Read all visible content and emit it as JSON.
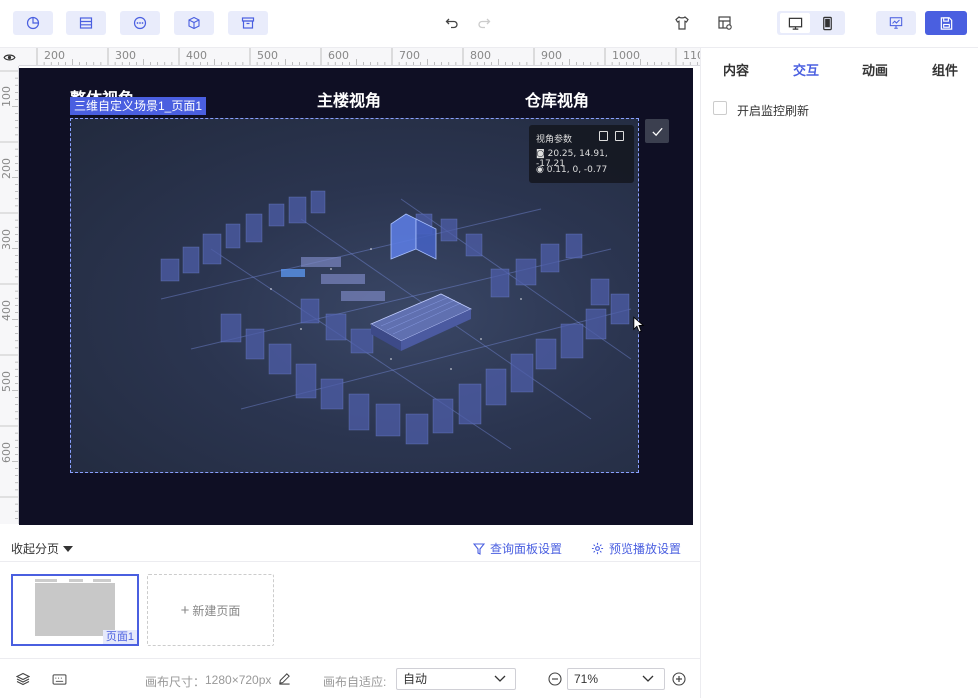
{
  "toolbar": {
    "left_icons": [
      "chart-icon",
      "table-icon",
      "more-circle-icon",
      "cube-icon",
      "archive-icon"
    ],
    "undo_icon": "undo-icon",
    "redo_icon": "redo-icon",
    "right_icons": [
      "shirt-icon",
      "layout-settings-icon",
      "desktop-icon",
      "mobile-icon",
      "preview-icon",
      "save-icon"
    ],
    "accent": "#4a5fe0"
  },
  "rulers": {
    "top_ticks": [
      "200",
      "300",
      "400",
      "500",
      "600",
      "700",
      "800",
      "900",
      "1000",
      "110"
    ],
    "left_ticks": [
      "100",
      "200",
      "300",
      "400",
      "500",
      "600"
    ]
  },
  "canvas": {
    "titles": [
      "整体视角",
      "主楼视角",
      "仓库视角"
    ],
    "scene_tag": "三维自定义场景1_页面1",
    "camera": {
      "title": "视角参数",
      "position": "20.25, 14.91, -17.21",
      "rotation": "0.11, 0, -0.77"
    },
    "background": "#0f0f24"
  },
  "pages": {
    "collapse_label": "收起分页",
    "query_label": "查询面板设置",
    "preview_label": "预览播放设置",
    "page_name": "页面1",
    "new_page_label": "新建页面"
  },
  "status": {
    "size_label": "画布尺寸：",
    "size_value": "1280×720px",
    "fit_label": "画布自适应:",
    "fit_value": "自动",
    "zoom_value": "71%"
  },
  "right_panel": {
    "tabs": [
      "内容",
      "交互",
      "动画",
      "组件"
    ],
    "active_tab": "交互",
    "option_label": "开启监控刷新"
  }
}
